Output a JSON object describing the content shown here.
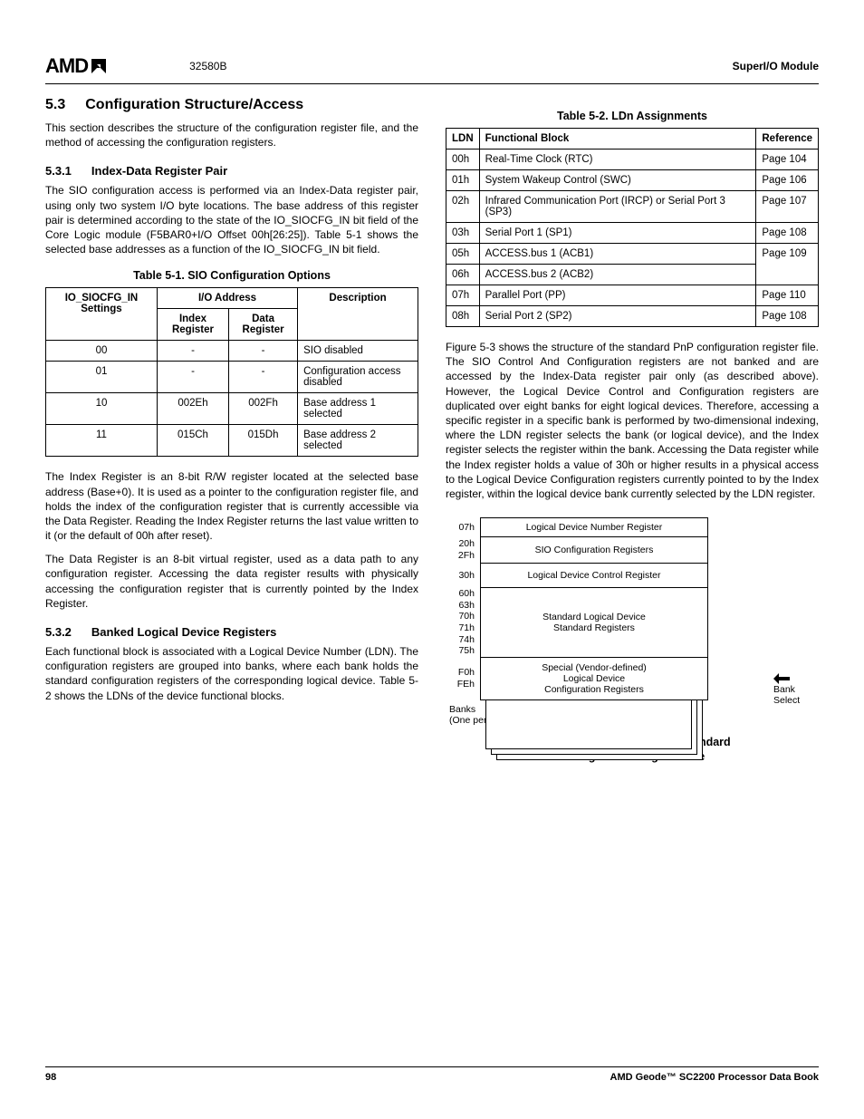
{
  "header": {
    "logo": "AMD",
    "doc_id": "32580B",
    "section_label": "SuperI/O Module"
  },
  "section": {
    "num": "5.3",
    "title": "Configuration Structure/Access",
    "intro": "This section describes the structure of the configuration register file, and the method of accessing the configuration registers."
  },
  "sub531": {
    "num": "5.3.1",
    "title": "Index-Data Register Pair",
    "p1": "The SIO configuration access is performed via an Index-Data register pair, using only two system I/O byte locations. The base address of this register pair is determined according to the state of the IO_SIOCFG_IN bit field of the Core Logic module (F5BAR0+I/O Offset 00h[26:25]). Table 5-1 shows the selected base addresses as a function of the IO_SIOCFG_IN bit field.",
    "p2": "The Index Register is an 8-bit R/W register located at the selected base address (Base+0). It is used as a pointer to the configuration register file, and holds the index of the configuration register that is currently accessible via the Data Register. Reading the Index Register returns the last value written to it (or the default of 00h after reset).",
    "p3": "The Data Register is an 8-bit virtual register, used as a data path to any configuration register. Accessing the data register results with physically accessing the configuration register that is currently pointed by the Index Register."
  },
  "table51": {
    "caption": "Table 5-1.  SIO Configuration Options",
    "head": {
      "c1": "IO_SIOCFG_IN Settings",
      "c2span": "I/O Address",
      "c2a": "Index Register",
      "c2b": "Data Register",
      "c3": "Description"
    },
    "rows": [
      {
        "s": "00",
        "idx": "-",
        "dat": "-",
        "desc": "SIO disabled"
      },
      {
        "s": "01",
        "idx": "-",
        "dat": "-",
        "desc": "Configuration access disabled"
      },
      {
        "s": "10",
        "idx": "002Eh",
        "dat": "002Fh",
        "desc": "Base address 1 selected"
      },
      {
        "s": "11",
        "idx": "015Ch",
        "dat": "015Dh",
        "desc": "Base address 2 selected"
      }
    ]
  },
  "sub532": {
    "num": "5.3.2",
    "title": "Banked Logical Device Registers",
    "p1": "Each functional block is associated with a Logical Device Number (LDN). The configuration registers are grouped into banks, where each bank holds the standard configuration registers of the corresponding logical device. Table 5-2 shows the LDNs of the device functional blocks."
  },
  "table52": {
    "caption": "Table 5-2.  LDn Assignments",
    "head": {
      "c1": "LDN",
      "c2": "Functional Block",
      "c3": "Reference"
    },
    "rows": [
      {
        "ldn": "00h",
        "fb": "Real-Time Clock (RTC)",
        "ref": "Page 104"
      },
      {
        "ldn": "01h",
        "fb": "System Wakeup Control (SWC)",
        "ref": "Page 106"
      },
      {
        "ldn": "02h",
        "fb": "Infrared Communication Port (IRCP) or Serial Port 3 (SP3)",
        "ref": "Page 107"
      },
      {
        "ldn": "03h",
        "fb": "Serial Port 1 (SP1)",
        "ref": "Page 108"
      },
      {
        "ldn": "05h",
        "fb": "ACCESS.bus 1 (ACB1)",
        "ref": "Page 109"
      },
      {
        "ldn": "06h",
        "fb": "ACCESS.bus 2 (ACB2)",
        "ref": ""
      },
      {
        "ldn": "07h",
        "fb": "Parallel Port (PP)",
        "ref": "Page 110"
      },
      {
        "ldn": "08h",
        "fb": "Serial Port 2 (SP2)",
        "ref": "Page 108"
      }
    ]
  },
  "rightcol": {
    "p_after_t52": "Figure 5-3 shows the structure of the standard PnP configuration register file. The SIO Control And Configuration registers are not banked and are accessed by the Index-Data register pair only (as described above). However, the Logical Device Control and Configuration registers are duplicated over eight banks for eight logical devices. Therefore, accessing a specific register in a specific bank is performed by two-dimensional indexing, where the LDN register selects the bank (or logical device), and the Index register selects the register within the bank. Accessing the Data register while the Index register holds a value of 30h or higher results in a physical access to the Logical Device Configuration registers currently pointed to by the Index register, within the logical device bank currently selected by the LDN register."
  },
  "figure53": {
    "caption_l1": "Figure 5-3.  Structure of the Standard",
    "caption_l2": "Configuration Register File",
    "rows": [
      {
        "addr_lines": [
          "07h"
        ],
        "label": "Logical Device Number Register"
      },
      {
        "addr_lines": [
          "20h",
          "2Fh"
        ],
        "label": "SIO Configuration Registers"
      },
      {
        "addr_lines": [
          "30h"
        ],
        "label": "Logical Device Control Register"
      },
      {
        "addr_lines": [
          "60h",
          "63h",
          "70h",
          "71h",
          "74h",
          "75h"
        ],
        "label_l1": "Standard Logical Device",
        "label_l2": "Standard Registers"
      },
      {
        "addr_lines": [
          "F0h",
          "",
          "FEh"
        ],
        "label_l1": "Special (Vendor-defined)",
        "label_l2": "Logical Device",
        "label_l3": "Configuration Registers"
      }
    ],
    "banks_label_l1": "Banks",
    "banks_label_l2": "(One per Logical Device)",
    "bank_select": "Bank Select"
  },
  "footer": {
    "page": "98",
    "book": "AMD Geode™ SC2200  Processor Data Book"
  }
}
